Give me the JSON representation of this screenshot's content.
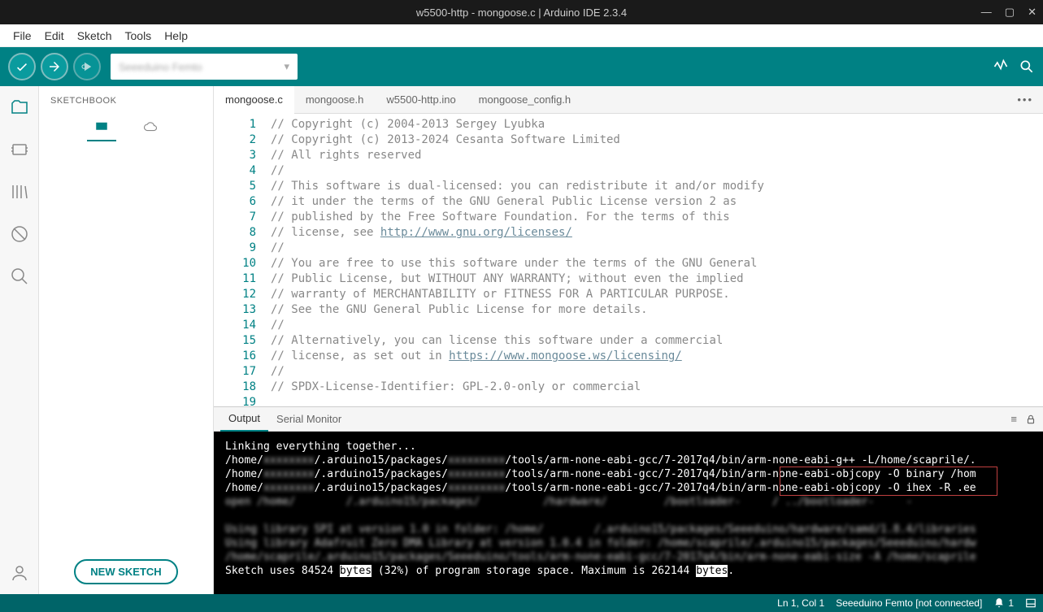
{
  "title": "w5500-http - mongoose.c | Arduino IDE 2.3.4",
  "menubar": [
    "File",
    "Edit",
    "Sketch",
    "Tools",
    "Help"
  ],
  "board_selector": "Seeeduino Femto",
  "sidebar": {
    "header": "SKETCHBOOK",
    "new_sketch": "NEW SKETCH"
  },
  "tabs": [
    {
      "label": "mongoose.c",
      "active": true
    },
    {
      "label": "mongoose.h",
      "active": false
    },
    {
      "label": "w5500-http.ino",
      "active": false
    },
    {
      "label": "mongoose_config.h",
      "active": false
    }
  ],
  "code": {
    "line_start": 1,
    "lines": [
      "// Copyright (c) 2004-2013 Sergey Lyubka",
      "// Copyright (c) 2013-2024 Cesanta Software Limited",
      "// All rights reserved",
      "//",
      "// This software is dual-licensed: you can redistribute it and/or modify",
      "// it under the terms of the GNU General Public License version 2 as",
      "// published by the Free Software Foundation. For the terms of this",
      "// license, see http://www.gnu.org/licenses/",
      "//",
      "// You are free to use this software under the terms of the GNU General",
      "// Public License, but WITHOUT ANY WARRANTY; without even the implied",
      "// warranty of MERCHANTABILITY or FITNESS FOR A PARTICULAR PURPOSE.",
      "// See the GNU General Public License for more details.",
      "//",
      "// Alternatively, you can license this software under a commercial",
      "// license, as set out in https://www.mongoose.ws/licensing/",
      "//",
      "// SPDX-License-Identifier: GPL-2.0-only or commercial",
      ""
    ]
  },
  "panel": {
    "tabs": [
      {
        "label": "Output",
        "active": true
      },
      {
        "label": "Serial Monitor",
        "active": false
      }
    ],
    "console": {
      "l0": "Linking everything together...",
      "l1a": "/home/",
      "l1b": "/.arduino15/packages/",
      "l1c": "/tools/arm-none-eabi-gcc/7-2017q4/bin/arm-none-eabi-g++ -L/home/scaprile/.",
      "l2a": "/home/",
      "l2b": "/.arduino15/packages/",
      "l2c": "/tools/arm-none-eabi-gcc/7-2017q4/bin/",
      "l2d": "arm-none-eabi-objcopy -O binary",
      "l2e": " /hom",
      "l3a": "/home/",
      "l3b": "/.arduino15/packages/",
      "l3c": "/tools/arm-none-eabi-gcc/7-2017q4/bin/",
      "l3d": "arm-none-eabi-objcopy -O ihex -R",
      "l3e": " .ee",
      "blur1": "open /home/        /.arduino15/packages/          /hardware/         /bootloader-     / ../bootloader-     -    ",
      "blur2": "Using library SPI at version 1.0 in folder: /home/        /.arduino15/packages/Seeeduino/hardware/samd/1.8.4/libraries",
      "blur3": "Using library Adafruit Zero DMA Library at version 1.0.4 in folder: /home/scaprile/.arduino15/packages/Seeeduino/hardw",
      "blur4": "/home/scaprile/.arduino15/packages/Seeeduino/tools/arm-none-eabi-gcc/7-2017q4/bin/arm-none-eabi-size -A /home/scaprile",
      "l8a": "Sketch uses 84524 ",
      "l8b": "bytes",
      "l8c": " (32%) of program storage space. Maximum is 262144 ",
      "l8d": "bytes",
      "l8e": "."
    }
  },
  "statusbar": {
    "position": "Ln 1, Col 1",
    "board": "Seeeduino Femto [not connected]",
    "notif_count": "1"
  }
}
